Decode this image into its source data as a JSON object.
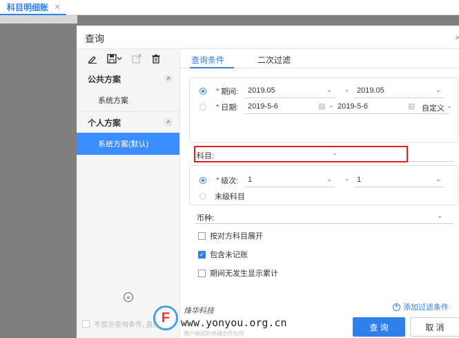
{
  "topbar": {
    "tab_label": "科目明细账",
    "tab_close": "✕"
  },
  "dialog": {
    "title": "查询",
    "close": "×"
  },
  "left": {
    "groups": [
      {
        "label": "公共方案",
        "schemes": [
          "系统方案"
        ]
      },
      {
        "label": "个人方案",
        "schemes": [
          "系统方案(默认)"
        ]
      }
    ],
    "collapse_icon": "^",
    "back_icon": "«"
  },
  "tabs": [
    "查询条件",
    "二次过滤"
  ],
  "period": {
    "period_label": "期间:",
    "period_from": "2019.05",
    "period_to": "2019.05",
    "date_label": "日期:",
    "date_from": "2019-5-6",
    "date_to": "2019-5-6",
    "custom": "自定义",
    "required_mark": "*",
    "dash": "-"
  },
  "subject": {
    "label": "科目:",
    "dash": "-"
  },
  "level": {
    "label": "级次:",
    "from": "1",
    "to": "1",
    "last_level": "末级科目",
    "required_mark": "*",
    "dash": "-"
  },
  "currency": {
    "label": "币种:"
  },
  "options": [
    {
      "label": "按对方科目展开",
      "checked": false
    },
    {
      "label": "包含未记账",
      "checked": true
    },
    {
      "label": "期间无发生显示累计",
      "checked": false
    }
  ],
  "add_filter": "添加过滤条件",
  "footer": {
    "hide_label": "不显示查询条件, 直接",
    "query": "查 询",
    "cancel": "取 消"
  },
  "watermark": {
    "logo_letter": "F",
    "cn": "烽华科技",
    "url": "www.yonyou.org.cn",
    "sub": "用户体验的卓越合作伙伴"
  },
  "colors": {
    "accent": "#2f80ed",
    "selected": "#3b8cff",
    "highlight_box": "#e02020"
  }
}
